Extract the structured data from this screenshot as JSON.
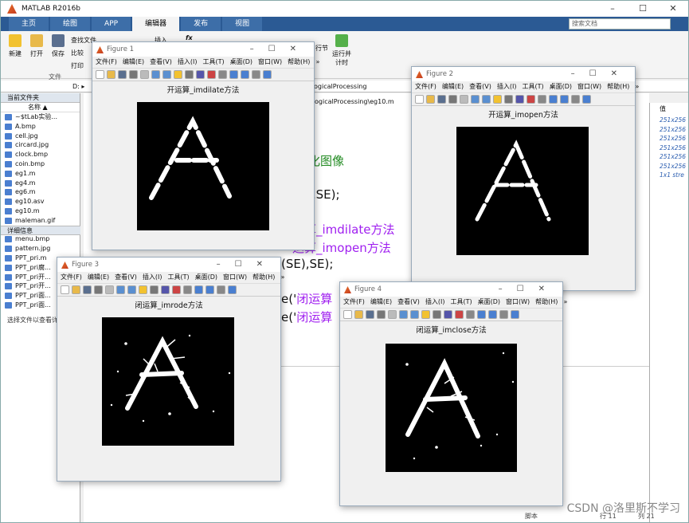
{
  "app": {
    "title": "MATLAB R2016b",
    "win_controls": [
      "–",
      "☐",
      "✕"
    ]
  },
  "tabs": [
    "主页",
    "绘图",
    "APP",
    "编辑器",
    "发布",
    "视图"
  ],
  "search_placeholder": "搜索文档",
  "ribbon": {
    "new": "新建",
    "open": "打开",
    "save": "保存",
    "find_file": "查找文件",
    "compare": "比较",
    "print": "打印",
    "insert": "插入",
    "fx": "fx",
    "section": "行节",
    "run_time": "运行并\n计时",
    "group_file": "文件"
  },
  "address": {
    "path_frag": "D: ▸",
    "editor_tab1": "ogicalProcessing",
    "editor_tab2": "ogicalProcessing\\eg10.m"
  },
  "left_panel": {
    "title": "当前文件夹",
    "col_name": "名称 ▲",
    "files": [
      "~$tLab实验...",
      "A.bmp",
      "cell.jpg",
      "circard.jpg",
      "clock.bmp",
      "coin.bmp",
      "eg1.m",
      "eg4.m",
      "eg6.m",
      "eg10.asv",
      "eg10.m",
      "maleman.gif",
      "MatLab实验...",
      "menu.bmp",
      "pattern.jpg",
      "PPT_pri.m",
      "PPT_pri腐...",
      "PPT_pri开...",
      "PPT_pri开...",
      "PPT_pri面...",
      "PPT_pri面..."
    ],
    "details_title": "详细信息",
    "details_text": "选择文件以查看详"
  },
  "editor": {
    "line1": "化图像",
    "line2": "SE),SE);",
    "line3": "运算_imdilate方法",
    "line4": "运算_imopen方法",
    "line5": "(SE),SE);",
    "line6a": "tle('",
    "line6b": "闭运算",
    "line7a": "tle('",
    "line7b": "闭运算"
  },
  "workspace": {
    "header": "值",
    "rows": [
      "251x256",
      "251x256",
      "251x256",
      "251x256",
      "251x256",
      "251x256",
      "1x1 stre"
    ]
  },
  "status": {
    "frag1": "脚本",
    "frag2": "行 11",
    "frag3": "列 21"
  },
  "watermark": "CSDN @洛里斯不学习",
  "figure_menu": [
    "文件(F)",
    "编辑(E)",
    "查看(V)",
    "插入(I)",
    "工具(T)",
    "桌面(D)",
    "窗口(W)",
    "帮助(H)",
    "»"
  ],
  "figures": [
    {
      "title": "Figure 1",
      "caption": "开运算_imdilate方法"
    },
    {
      "title": "Figure 2",
      "caption": "开运算_imopen方法"
    },
    {
      "title": "Figure 3",
      "caption": "闭运算_imrode方法"
    },
    {
      "title": "Figure 4",
      "caption": "闭运算_imclose方法"
    }
  ]
}
